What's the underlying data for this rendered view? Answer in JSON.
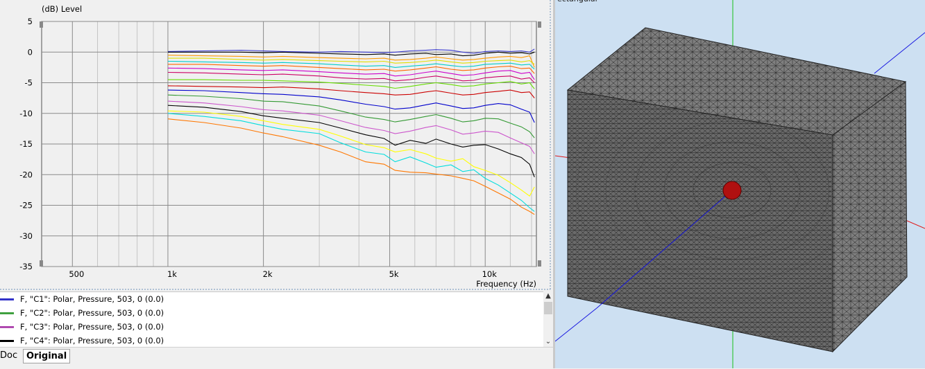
{
  "chart_data": {
    "type": "line",
    "ylabel": "(dB)  Level",
    "xlabel": "Frequency  (Hz)",
    "xscale": "log",
    "xlim": [
      400,
      14500
    ],
    "ylim": [
      -35,
      5
    ],
    "grid": true,
    "y_ticks": [
      5,
      0,
      -5,
      -10,
      -15,
      -20,
      -25,
      -30,
      -35
    ],
    "x_ticks": [
      {
        "value": 500,
        "label": "500"
      },
      {
        "value": 1000,
        "label": "1k"
      },
      {
        "value": 2000,
        "label": "2k"
      },
      {
        "value": 5000,
        "label": "5k"
      },
      {
        "value": 10000,
        "label": "10k"
      }
    ],
    "x": [
      1000,
      1300,
      1700,
      2000,
      2300,
      3000,
      3500,
      4200,
      4800,
      5200,
      5800,
      6500,
      7000,
      7800,
      8500,
      9200,
      10000,
      11000,
      12000,
      13000,
      13800,
      14300
    ],
    "series": [
      {
        "color": "#3b3bd0",
        "values": [
          0.1,
          0.2,
          0.3,
          0.2,
          0.1,
          0.0,
          0.1,
          0.0,
          -0.1,
          0.0,
          0.2,
          0.3,
          0.4,
          0.3,
          0.0,
          -0.2,
          0.1,
          0.2,
          0.1,
          0.2,
          0.0,
          0.5
        ]
      },
      {
        "color": "#000000",
        "values": [
          0.0,
          0.0,
          0.0,
          -0.1,
          0.0,
          -0.2,
          -0.3,
          -0.4,
          -0.3,
          -0.5,
          -0.3,
          -0.2,
          -0.4,
          -0.3,
          -0.6,
          -0.5,
          -0.2,
          0.0,
          -0.2,
          -0.1,
          -0.3,
          0.0
        ]
      },
      {
        "color": "#ff9900",
        "values": [
          -0.5,
          -0.6,
          -0.7,
          -0.8,
          -0.7,
          -0.9,
          -1.0,
          -1.1,
          -1.0,
          -1.3,
          -1.2,
          -1.0,
          -0.8,
          -1.1,
          -1.3,
          -1.2,
          -1.0,
          -0.8,
          -0.7,
          -0.9,
          -0.6,
          -2.5
        ]
      },
      {
        "color": "#e0e000",
        "values": [
          -1.0,
          -1.0,
          -1.2,
          -1.3,
          -1.2,
          -1.4,
          -1.5,
          -1.6,
          -1.5,
          -1.8,
          -1.7,
          -1.5,
          -1.3,
          -1.6,
          -1.8,
          -1.7,
          -1.5,
          -1.4,
          -1.3,
          -1.6,
          -1.4,
          -2.0
        ]
      },
      {
        "color": "#00cccc",
        "values": [
          -1.5,
          -1.6,
          -1.7,
          -1.8,
          -1.7,
          -1.9,
          -2.1,
          -2.3,
          -2.2,
          -2.5,
          -2.3,
          -2.1,
          -1.9,
          -2.2,
          -2.4,
          -2.3,
          -2.0,
          -1.9,
          -1.8,
          -2.1,
          -2.0,
          -2.8
        ]
      },
      {
        "color": "#ff6600",
        "values": [
          -2.0,
          -2.0,
          -2.2,
          -2.3,
          -2.2,
          -2.5,
          -2.7,
          -2.9,
          -2.8,
          -3.1,
          -2.9,
          -2.6,
          -2.4,
          -2.8,
          -3.0,
          -2.9,
          -2.6,
          -2.4,
          -2.3,
          -2.7,
          -2.6,
          -3.5
        ]
      },
      {
        "color": "#cc00cc",
        "values": [
          -2.6,
          -2.7,
          -2.9,
          -3.0,
          -2.9,
          -3.2,
          -3.4,
          -3.6,
          -3.5,
          -3.9,
          -3.7,
          -3.3,
          -3.1,
          -3.5,
          -3.8,
          -3.7,
          -3.4,
          -3.1,
          -3.0,
          -3.5,
          -3.3,
          -4.5
        ]
      },
      {
        "color": "#cc0066",
        "values": [
          -3.3,
          -3.4,
          -3.6,
          -3.7,
          -3.6,
          -3.9,
          -4.2,
          -4.4,
          -4.3,
          -4.7,
          -4.5,
          -4.1,
          -3.9,
          -4.3,
          -4.7,
          -4.6,
          -4.2,
          -4.0,
          -3.9,
          -4.4,
          -4.2,
          -5.0
        ]
      },
      {
        "color": "#66dd00",
        "values": [
          -4.5,
          -4.5,
          -4.6,
          -4.6,
          -4.7,
          -4.9,
          -5.1,
          -5.4,
          -5.6,
          -5.9,
          -5.6,
          -5.2,
          -5.0,
          -5.3,
          -5.6,
          -5.5,
          -5.2,
          -5.0,
          -4.8,
          -5.2,
          -5.0,
          -6.0
        ]
      },
      {
        "color": "#cc0000",
        "values": [
          -5.5,
          -5.6,
          -5.7,
          -5.8,
          -5.7,
          -6.0,
          -6.3,
          -6.6,
          -6.8,
          -7.0,
          -6.9,
          -6.5,
          -6.3,
          -6.7,
          -7.0,
          -6.9,
          -6.6,
          -6.4,
          -6.2,
          -6.6,
          -6.5,
          -7.5
        ]
      },
      {
        "color": "#0000cc",
        "values": [
          -6.2,
          -6.3,
          -6.6,
          -6.8,
          -6.9,
          -7.3,
          -7.8,
          -8.5,
          -8.9,
          -9.3,
          -9.1,
          -8.6,
          -8.3,
          -8.8,
          -9.2,
          -9.1,
          -8.7,
          -8.4,
          -8.6,
          -9.3,
          -9.8,
          -11.5
        ]
      },
      {
        "color": "#339933",
        "values": [
          -7.0,
          -7.2,
          -7.6,
          -8.0,
          -8.1,
          -8.8,
          -9.6,
          -10.6,
          -11.0,
          -11.4,
          -11.0,
          -10.5,
          -10.2,
          -10.8,
          -11.4,
          -11.2,
          -10.8,
          -10.9,
          -11.6,
          -12.2,
          -13.0,
          -14.0
        ]
      },
      {
        "color": "#cc55cc",
        "values": [
          -8.0,
          -8.3,
          -8.9,
          -9.4,
          -9.6,
          -10.3,
          -11.2,
          -12.3,
          -12.8,
          -13.3,
          -12.9,
          -12.3,
          -12.0,
          -12.7,
          -13.4,
          -13.2,
          -12.9,
          -13.1,
          -14.0,
          -14.8,
          -15.4,
          -16.6
        ]
      },
      {
        "color": "#000000",
        "values": [
          -8.7,
          -9.0,
          -9.7,
          -10.4,
          -10.8,
          -11.5,
          -12.4,
          -13.5,
          -14.1,
          -15.2,
          -14.4,
          -14.9,
          -14.2,
          -15.0,
          -15.5,
          -15.2,
          -15.1,
          -15.8,
          -16.6,
          -17.2,
          -18.3,
          -20.4
        ]
      },
      {
        "color": "#ffff00",
        "values": [
          -9.6,
          -9.8,
          -10.5,
          -11.2,
          -11.8,
          -12.6,
          -13.7,
          -15.1,
          -15.6,
          -16.3,
          -15.9,
          -16.6,
          -17.3,
          -17.8,
          -17.4,
          -18.7,
          -19.3,
          -20.1,
          -21.3,
          -22.5,
          -23.5,
          -22.0
        ]
      },
      {
        "color": "#00dddd",
        "values": [
          -10.0,
          -10.5,
          -11.2,
          -12.0,
          -12.6,
          -13.3,
          -14.8,
          -16.3,
          -16.7,
          -17.9,
          -17.1,
          -18.1,
          -18.8,
          -18.4,
          -19.5,
          -19.2,
          -20.6,
          -21.7,
          -23.0,
          -24.2,
          -25.4,
          -26.0
        ]
      },
      {
        "color": "#ff7700",
        "values": [
          -10.9,
          -11.5,
          -12.4,
          -13.2,
          -13.8,
          -15.2,
          -16.3,
          -17.9,
          -18.3,
          -19.3,
          -19.6,
          -19.7,
          -19.9,
          -20.2,
          -20.6,
          -21.0,
          -21.9,
          -23.0,
          -24.0,
          -25.3,
          -26.0,
          -26.5
        ]
      }
    ]
  },
  "legend": [
    {
      "label": "F, \"C1\": Polar, Pressure, 503, 0 (0.0)",
      "color": "#3232c8"
    },
    {
      "label": "F, \"C2\": Polar, Pressure, 503, 0 (0.0)",
      "color": "#3fa03f"
    },
    {
      "label": "F, \"C3\": Polar, Pressure, 503, 0 (0.0)",
      "color": "#b04ab0"
    },
    {
      "label": "F, \"C4\": Polar, Pressure, 503, 0 (0.0)",
      "color": "#000000"
    }
  ],
  "tabs": [
    {
      "label": "Doc"
    },
    {
      "label": "Original"
    }
  ],
  "view3d": {
    "title": "ectangular",
    "mesh_color": "#7f7f7f",
    "mesh_line_color": "#1e1e1e",
    "source_color": "#b01010",
    "axis_x_color": "#e01818",
    "axis_y_color": "#18c018",
    "axis_z_color": "#1818e0",
    "background": "#cde0f2"
  }
}
